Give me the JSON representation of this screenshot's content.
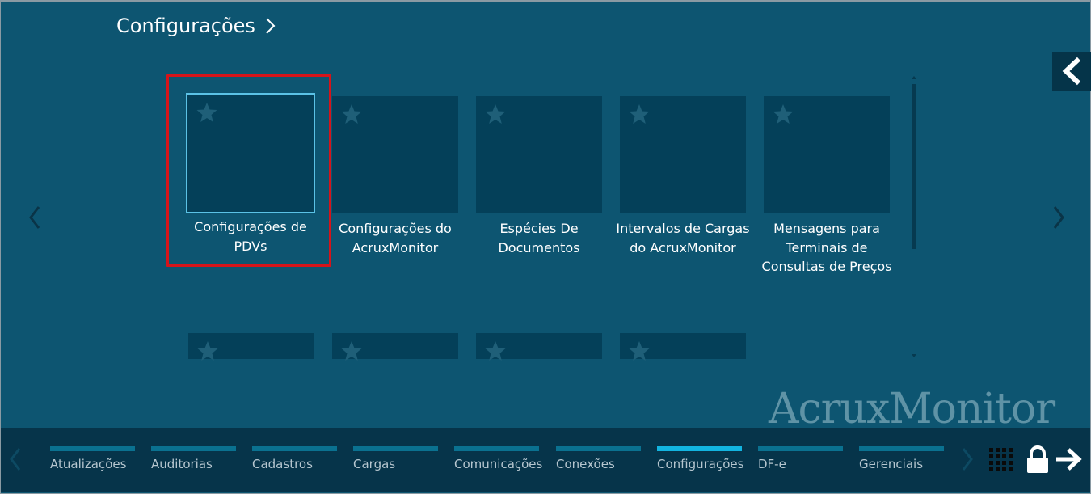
{
  "header": {
    "title": "Configurações",
    "chevron_icon": "chevron-right-icon"
  },
  "collapse_button": {
    "icon": "chevron-left-icon"
  },
  "nav": {
    "left_icon": "chevron-left-icon",
    "right_icon": "chevron-right-icon"
  },
  "tiles": [
    {
      "label": "Configurações de PDVs",
      "starred": false,
      "selected": true
    },
    {
      "label": "Configurações do AcruxMonitor",
      "starred": false
    },
    {
      "label": "Espécies De Documentos",
      "starred": false
    },
    {
      "label": "Intervalos de Cargas do AcruxMonitor",
      "starred": false
    },
    {
      "label": "Mensagens para Terminais de Consultas de Preços",
      "starred": false
    }
  ],
  "partial_tiles_count_visible": 4,
  "watermark": "AcruxMonitor",
  "taskbar": {
    "items": [
      {
        "label": "Atualizações"
      },
      {
        "label": "Auditorias"
      },
      {
        "label": "Cadastros"
      },
      {
        "label": "Cargas"
      },
      {
        "label": "Comunicações"
      },
      {
        "label": "Conexões"
      },
      {
        "label": "Configurações",
        "active": true
      },
      {
        "label": "DF-e"
      },
      {
        "label": "Gerenciais"
      }
    ],
    "icons": [
      "grid-icon",
      "lock-icon",
      "arrow-right-icon"
    ]
  },
  "colors": {
    "background": "#0e5570",
    "tile": "#044059",
    "tile_selected_border": "#5bc2e6",
    "highlight": "#d5141a",
    "taskbar": "#06344a",
    "taskbar_bar": "#0a7190",
    "taskbar_bar_active": "#12b4e0"
  }
}
